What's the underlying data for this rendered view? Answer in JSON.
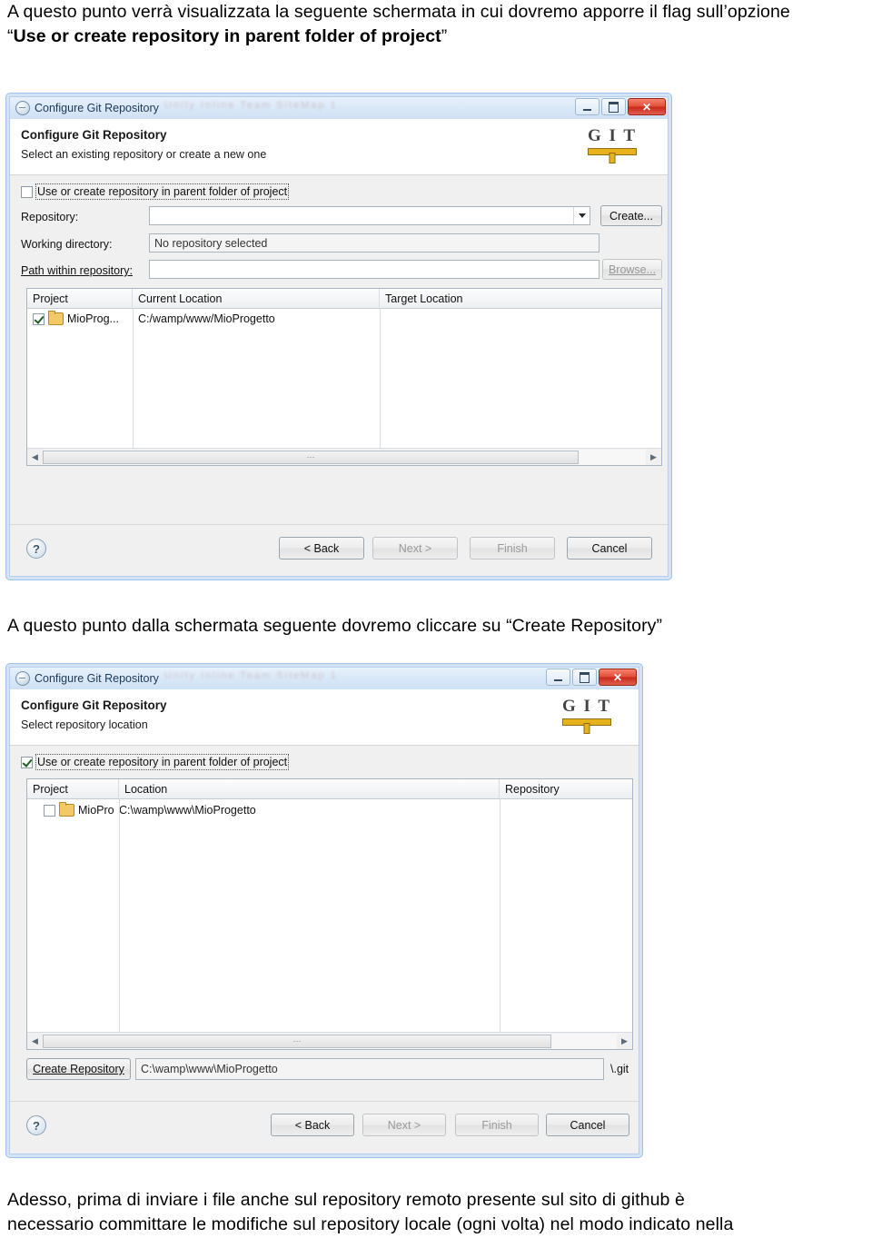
{
  "paragraphs": {
    "p1_line1": "A questo punto verrà visualizzata la seguente schermata in cui dovremo apporre il flag sull’opzione",
    "p1_bold": "Use or create repository in parent folder of project",
    "p1_quote_open": "“",
    "p1_quote_close": "”",
    "p2": "A questo punto dalla schermata seguente dovremo cliccare su “Create Repository”",
    "p3_line1": "Adesso, prima di inviare i file anche sul repository remoto presente sul sito di github è",
    "p3_line2": "necessario committare le modifiche sul repository locale (ogni volta) nel modo indicato nella"
  },
  "dialog1": {
    "titlebar": {
      "title": "Configure Git Repository",
      "ghost_text": "Unity Inline Team SiteMap 1",
      "minimize": "_",
      "maximize": "□",
      "close": "✕"
    },
    "header": {
      "title": "Configure Git Repository",
      "subtitle": "Select an existing repository or create a new one",
      "logo": "G I T"
    },
    "checkbox": {
      "label": "Use or create repository in parent folder of project",
      "checked": false
    },
    "fields": [
      {
        "label": "Repository:",
        "value": "",
        "type": "combo"
      },
      {
        "label": "Working directory:",
        "value": "No repository selected",
        "type": "readonly"
      },
      {
        "label": "Path within repository:",
        "value": "",
        "type": "text"
      }
    ],
    "buttons": {
      "create": "Create...",
      "browse": "Browse..."
    },
    "table": {
      "columns": [
        "Project",
        "Current Location",
        "Target Location"
      ],
      "rows": [
        {
          "checked": true,
          "project": "MioProg...",
          "current": "C:/wamp/www/MioProgetto",
          "target": ""
        }
      ]
    },
    "footer": {
      "help": "?",
      "back": "< Back",
      "next": "Next >",
      "finish": "Finish",
      "cancel": "Cancel"
    }
  },
  "dialog2": {
    "titlebar": {
      "title": "Configure Git Repository",
      "ghost_text": "Unity Inline Team SiteMap 1",
      "minimize": "_",
      "maximize": "□",
      "close": "✕"
    },
    "header": {
      "title": "Configure Git Repository",
      "subtitle": "Select repository location",
      "logo": "G I T"
    },
    "checkbox": {
      "label": "Use or create repository in parent folder of project",
      "checked": true
    },
    "table": {
      "columns": [
        "Project",
        "Location",
        "Repository"
      ],
      "rows": [
        {
          "checked": false,
          "project": "MioPro",
          "location": "C:\\wamp\\www\\MioProgetto",
          "repository": ""
        }
      ]
    },
    "create_row": {
      "button": "Create Repository",
      "path": "C:\\wamp\\www\\MioProgetto",
      "suffix": "\\.git"
    },
    "footer": {
      "help": "?",
      "back": "< Back",
      "next": "Next >",
      "finish": "Finish",
      "cancel": "Cancel"
    }
  }
}
